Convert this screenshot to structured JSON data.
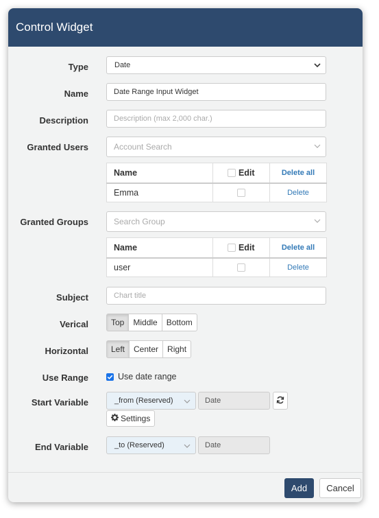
{
  "dialog": {
    "title": "Control Widget"
  },
  "form": {
    "type": {
      "label": "Type",
      "value": "Date"
    },
    "name": {
      "label": "Name",
      "value": "Date Range Input Widget"
    },
    "description": {
      "label": "Description",
      "placeholder": "Description (max 2,000 char.)"
    },
    "granted_users": {
      "label": "Granted Users",
      "search_placeholder": "Account Search",
      "col_name": "Name",
      "col_edit": "Edit",
      "delete_all": "Delete all",
      "rows": [
        {
          "name": "Emma",
          "delete": "Delete",
          "edit": false
        }
      ]
    },
    "granted_groups": {
      "label": "Granted Groups",
      "search_placeholder": "Search Group",
      "col_name": "Name",
      "col_edit": "Edit",
      "delete_all": "Delete all",
      "rows": [
        {
          "name": "user",
          "delete": "Delete",
          "edit": false
        }
      ]
    },
    "subject": {
      "label": "Subject",
      "placeholder": "Chart title"
    },
    "vertical": {
      "label": "Verical",
      "options": [
        "Top",
        "Middle",
        "Bottom"
      ],
      "selected": "Top"
    },
    "horizontal": {
      "label": "Horizontal",
      "options": [
        "Left",
        "Center",
        "Right"
      ],
      "selected": "Left"
    },
    "use_range": {
      "label": "Use Range",
      "checkbox_label": "Use date range",
      "checked": true
    },
    "start_variable": {
      "label": "Start Variable",
      "value": "_from (Reserved)",
      "type": "Date",
      "settings_label": "Settings"
    },
    "end_variable": {
      "label": "End Variable",
      "value": "_to (Reserved)",
      "type": "Date"
    }
  },
  "footer": {
    "add_label": "Add",
    "cancel_label": "Cancel"
  },
  "colors": {
    "header_bg": "#2e4a6e",
    "link": "#337ab7",
    "dialog_bg": "#f2f3f3"
  }
}
